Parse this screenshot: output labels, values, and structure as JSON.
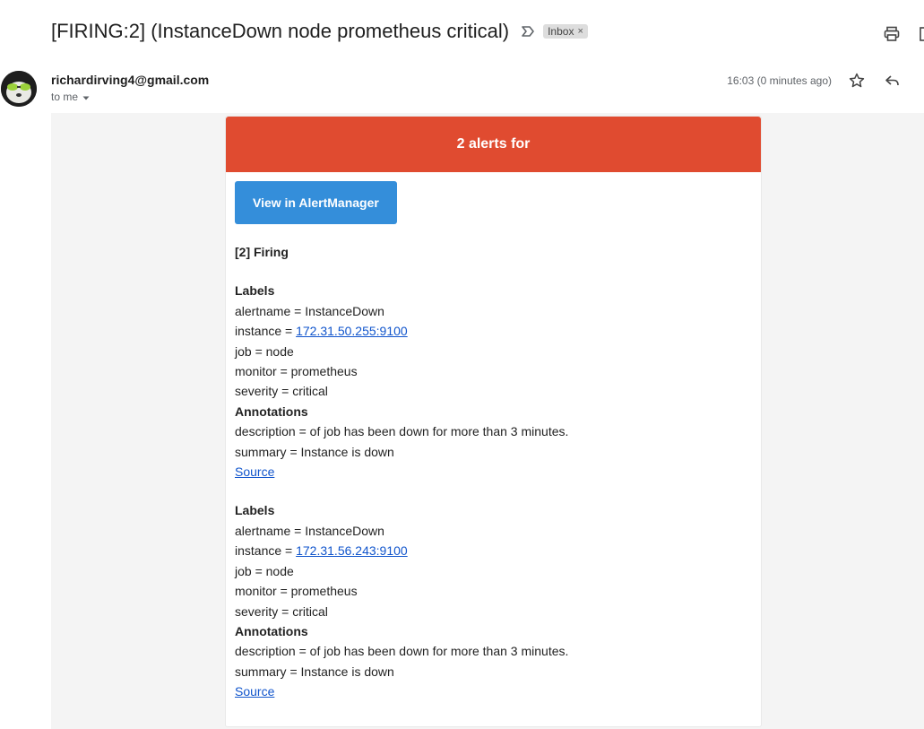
{
  "email": {
    "subject": "[FIRING:2] (InstanceDown node prometheus critical)",
    "label": "Inbox",
    "sender": "richardirving4@gmail.com",
    "to": "to me",
    "timestamp": "16:03 (0 minutes ago)"
  },
  "icons": {
    "important": "important-marker-icon",
    "print": "print-icon",
    "popout": "open-in-new-window-icon",
    "star": "star-icon",
    "reply": "reply-icon",
    "caret": "chevron-down-icon"
  },
  "message": {
    "header": "2 alerts for",
    "header_color": "#e04b30",
    "button_label": "View in AlertManager",
    "button_color": "#348eda",
    "firing_title": "[2] Firing",
    "alerts": [
      {
        "labels_title": "Labels",
        "alertname": "alertname = InstanceDown",
        "instance_prefix": "instance = ",
        "instance_link": "172.31.50.255:9100",
        "job": "job = node",
        "monitor": "monitor = prometheus",
        "severity": "severity = critical",
        "annotations_title": "Annotations",
        "description": "description = of job has been down for more than 3 minutes.",
        "summary": "summary = Instance is down",
        "source": "Source"
      },
      {
        "labels_title": "Labels",
        "alertname": "alertname = InstanceDown",
        "instance_prefix": "instance = ",
        "instance_link": "172.31.56.243:9100",
        "job": "job = node",
        "monitor": "monitor = prometheus",
        "severity": "severity = critical",
        "annotations_title": "Annotations",
        "description": "description = of job has been down for more than 3 minutes.",
        "summary": "summary = Instance is down",
        "source": "Source"
      }
    ]
  }
}
